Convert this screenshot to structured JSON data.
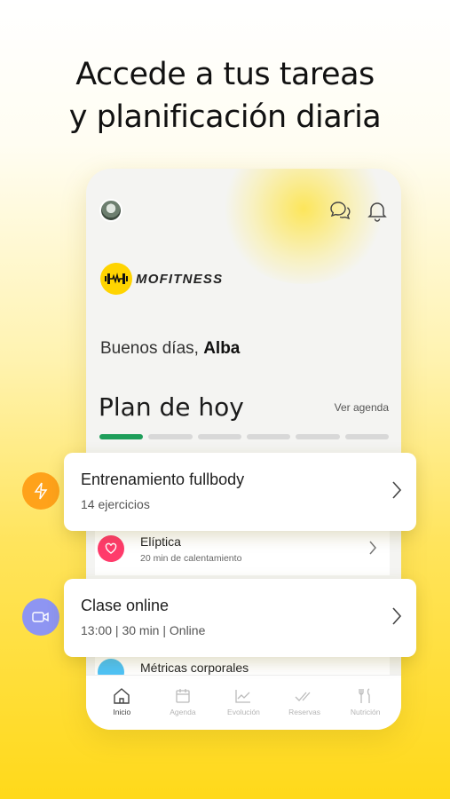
{
  "headline": {
    "line1": "Accede a tus tareas",
    "line2": "y planificación diaria"
  },
  "app": {
    "brand": "MOFITNESS",
    "greeting_prefix": "Buenos días, ",
    "user_name": "Alba",
    "plan_title": "Plan de hoy",
    "agenda_link": "Ver agenda",
    "progress": {
      "segments": 6,
      "completed": 1
    },
    "items": [
      {
        "title": "Elíptica",
        "subtitle": "20 min de calentamiento",
        "icon": "heart-icon",
        "color": "#ff3b6b"
      },
      {
        "title": "Métricas corporales",
        "subtitle": "",
        "icon": "metrics-icon",
        "color": "#4fc3f7"
      }
    ],
    "tabs": [
      {
        "label": "Inicio",
        "icon": "home-icon",
        "active": true
      },
      {
        "label": "Agenda",
        "icon": "calendar-icon",
        "active": false
      },
      {
        "label": "Evolución",
        "icon": "chart-icon",
        "active": false
      },
      {
        "label": "Reservas",
        "icon": "checkmarks-icon",
        "active": false
      },
      {
        "label": "Nutrición",
        "icon": "cutlery-icon",
        "active": false
      }
    ]
  },
  "floating_cards": [
    {
      "title": "Entrenamiento fullbody",
      "subtitle": "14 ejercicios",
      "icon": "lightning-icon",
      "color": "#ffa21a"
    },
    {
      "title": "Clase online",
      "subtitle": "13:00 | 30 min | Online",
      "icon": "video-camera-icon",
      "color": "#8e95f2"
    }
  ],
  "colors": {
    "accent": "#ffd400",
    "progress_done": "#1e9e5a"
  }
}
